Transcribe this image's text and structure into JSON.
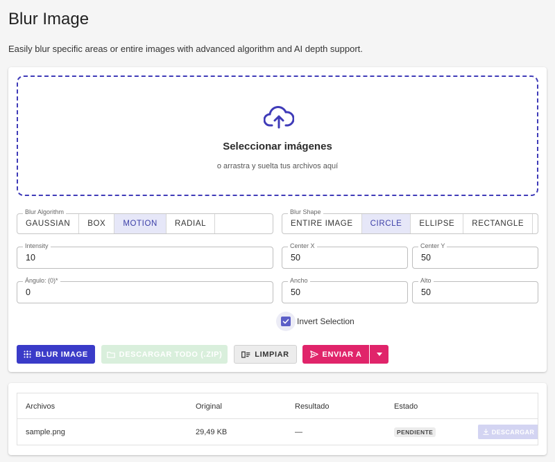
{
  "page": {
    "title": "Blur Image",
    "description": "Easily blur specific areas or entire images with advanced algorithm and AI depth support."
  },
  "dropzone": {
    "icon": "cloud-upload-icon",
    "title": "Seleccionar imágenes",
    "subtitle": "o arrastra y suelta tus archivos aquí"
  },
  "blur_algorithm": {
    "label": "Blur Algorithm",
    "options": [
      "GAUSSIAN",
      "BOX",
      "MOTION",
      "RADIAL"
    ],
    "selected": "MOTION"
  },
  "blur_shape": {
    "label": "Blur Shape",
    "options": [
      "ENTIRE IMAGE",
      "CIRCLE",
      "ELLIPSE",
      "RECTANGLE"
    ],
    "selected": "CIRCLE"
  },
  "fields": {
    "intensity": {
      "label": "Intensity",
      "value": "10"
    },
    "center_x": {
      "label": "Center X",
      "value": "50"
    },
    "center_y": {
      "label": "Center Y",
      "value": "50"
    },
    "angle": {
      "label": "Ángulo: (0)*",
      "value": "0"
    },
    "width": {
      "label": "Ancho",
      "value": "50"
    },
    "height": {
      "label": "Alto",
      "value": "50"
    }
  },
  "invert_selection": {
    "label": "Invert Selection",
    "checked": true
  },
  "actions": {
    "blur": "BLUR IMAGE",
    "download_all": "DESCARGAR TODO (.ZIP)",
    "clear": "LIMPIAR",
    "send_to": "ENVIAR A"
  },
  "table": {
    "headers": [
      "Archivos",
      "Original",
      "Resultado",
      "Estado"
    ],
    "rows": [
      {
        "file": "sample.png",
        "original": "29,49 KB",
        "result": "—",
        "status": "PENDIENTE",
        "download": "DESCARGAR"
      }
    ]
  },
  "colors": {
    "primary": "#3a3bc8",
    "accent": "#e0246a",
    "success_disabled": "#d9efdc",
    "active_toggle_bg": "#e6e7f8"
  }
}
